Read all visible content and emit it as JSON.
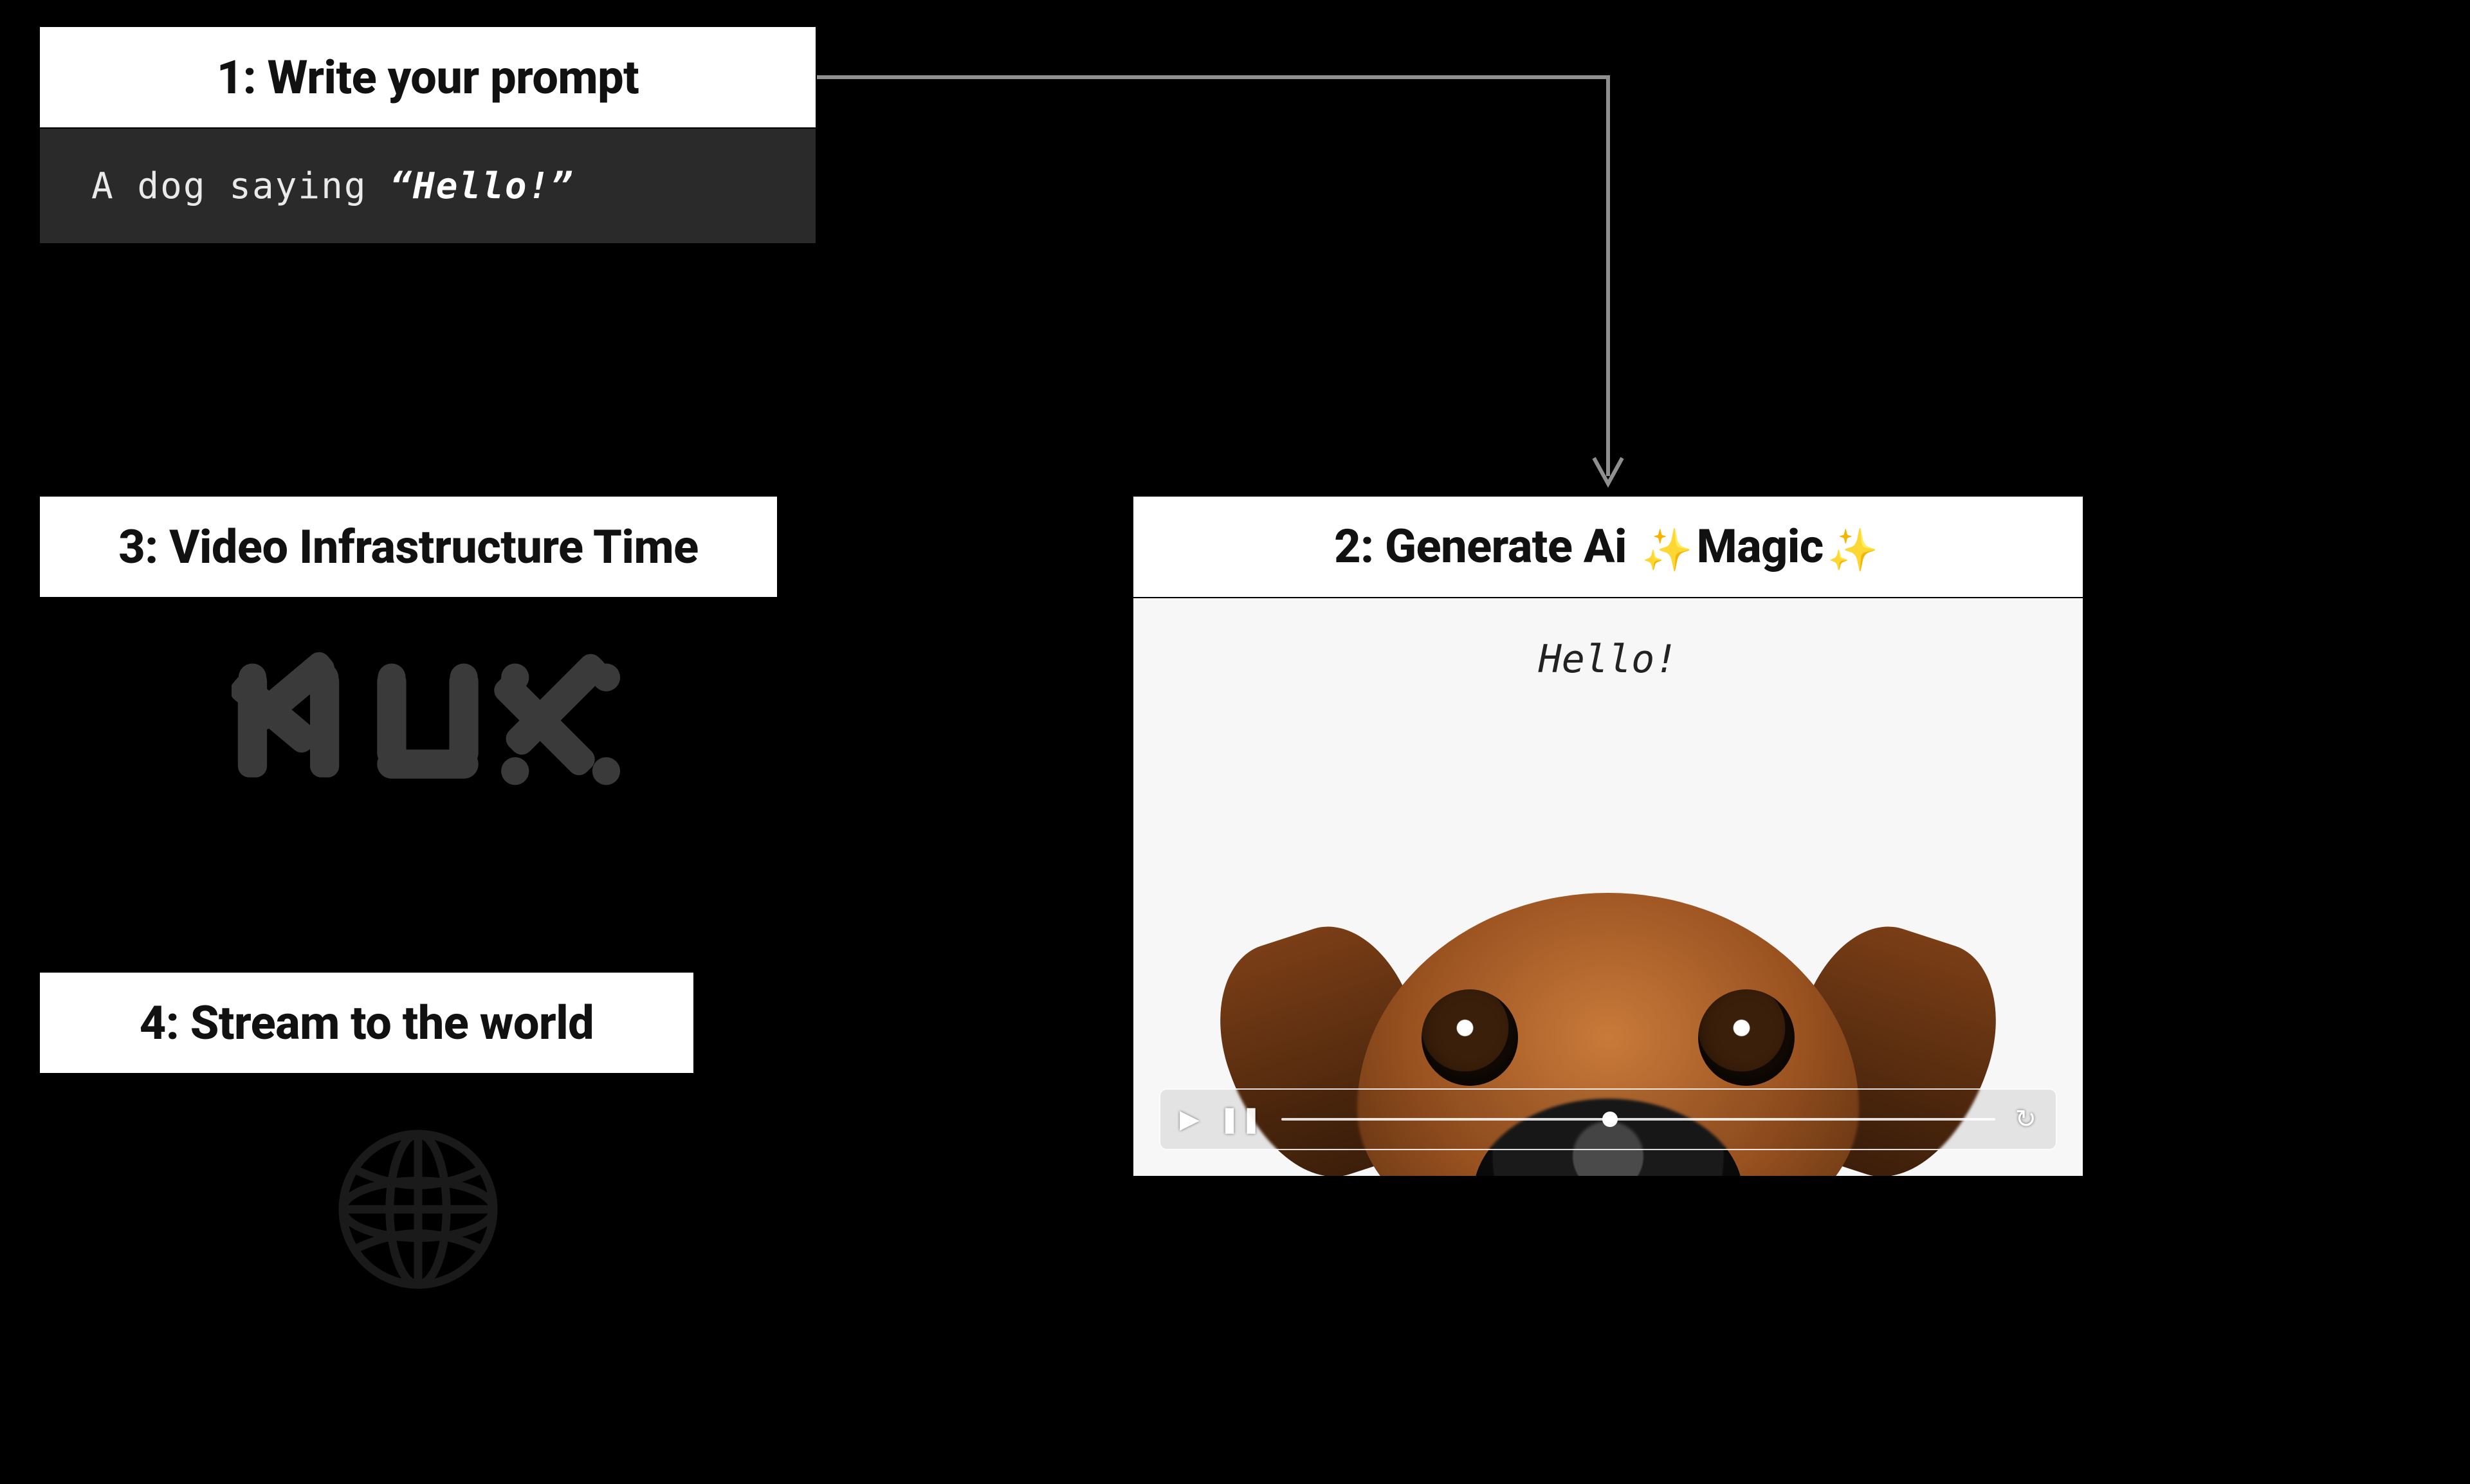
{
  "steps": {
    "one": {
      "title": "1: Write your prompt"
    },
    "two": {
      "title_pre": "2: Generate Ai ",
      "title_mid": "Magic"
    },
    "three": {
      "title": "3: Video Infrastructure Time",
      "logo_text": "MUX"
    },
    "four": {
      "title": "4: Stream to the world"
    }
  },
  "prompt": {
    "prefix": "A dog saying ",
    "quoted": "“Hello!”"
  },
  "video": {
    "speech_text": "Hello!",
    "controls": {
      "play_glyph": "▶",
      "pause_glyph": "❚❚",
      "loop_glyph": "↻",
      "progress_fraction": 0.46
    }
  },
  "icons": {
    "sparkle": "✨",
    "globe": "globe-icon"
  },
  "colors": {
    "background": "#000000",
    "card": "#ffffff",
    "dark_panel": "#2a2a2a",
    "sparkle_gold": "#f5b82e",
    "connector": "#8f8f8f"
  }
}
